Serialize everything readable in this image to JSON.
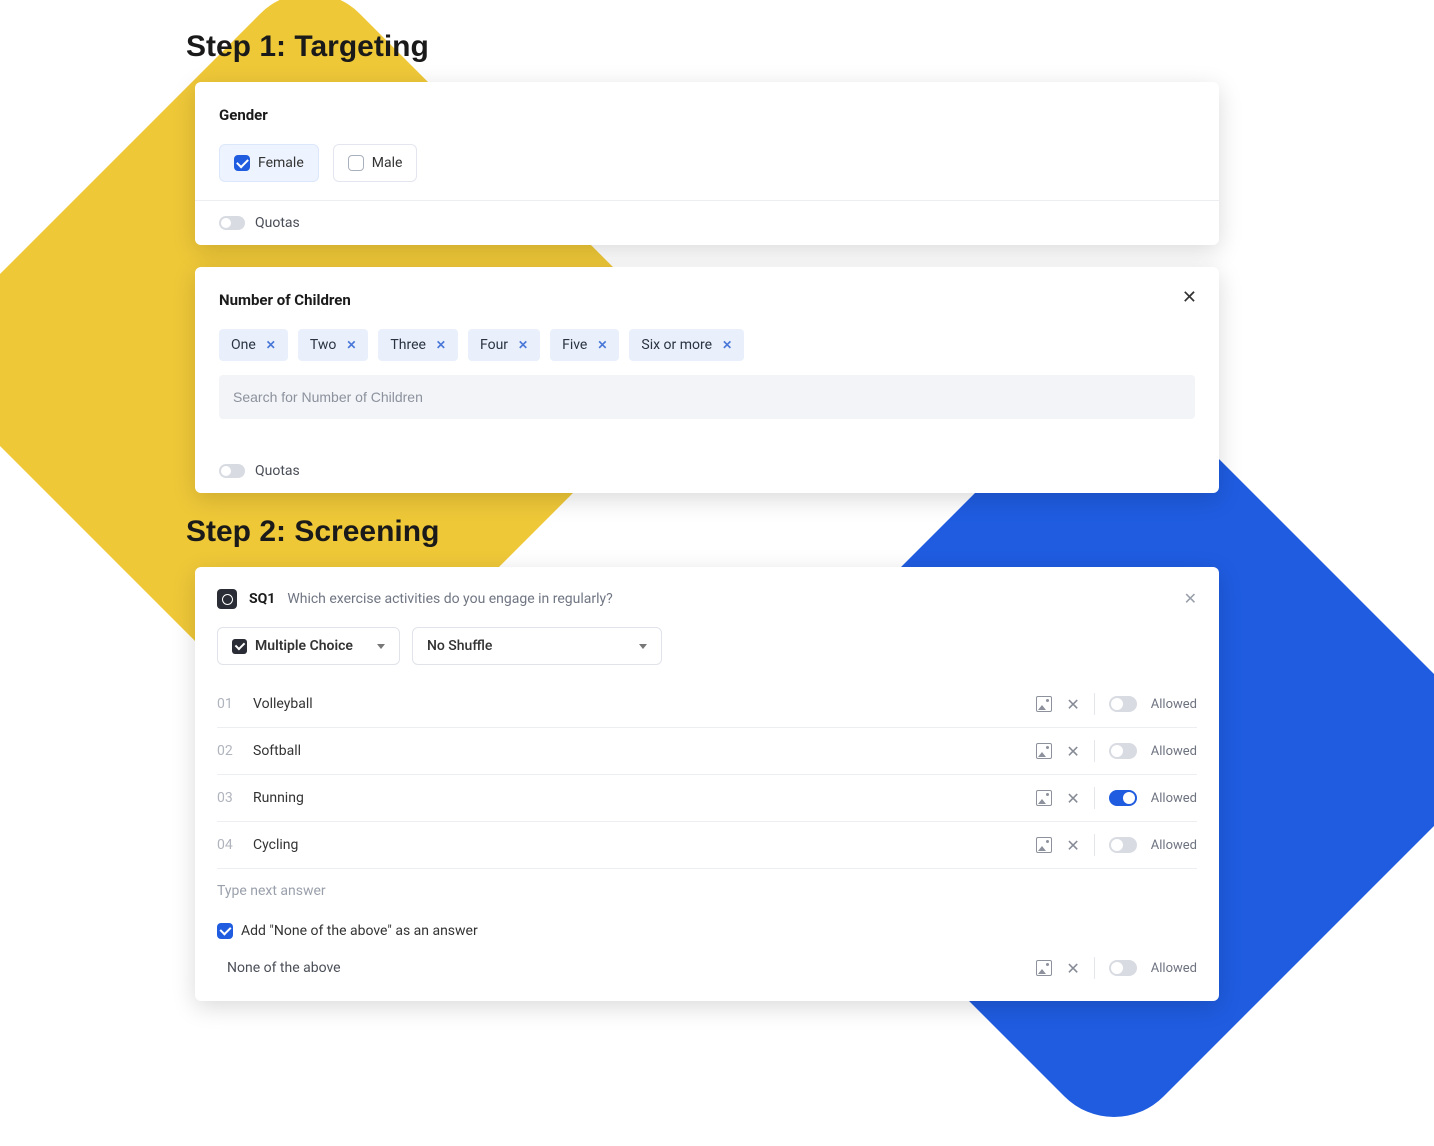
{
  "step1": {
    "heading": "Step 1: Targeting",
    "gender": {
      "title": "Gender",
      "options": [
        {
          "label": "Female",
          "checked": true
        },
        {
          "label": "Male",
          "checked": false
        }
      ],
      "quotas_label": "Quotas"
    },
    "children": {
      "title": "Number of Children",
      "chips": [
        "One",
        "Two",
        "Three",
        "Four",
        "Five",
        "Six or more"
      ],
      "search_placeholder": "Search for Number of Children",
      "quotas_label": "Quotas"
    }
  },
  "step2": {
    "heading": "Step 2: Screening",
    "question": {
      "id": "SQ1",
      "text": "Which exercise activities do you engage in regularly?",
      "type_label": "Multiple Choice",
      "shuffle_label": "No Shuffle",
      "answers": [
        {
          "num": "01",
          "text": "Volleyball",
          "allowed": false
        },
        {
          "num": "02",
          "text": "Softball",
          "allowed": false
        },
        {
          "num": "03",
          "text": "Running",
          "allowed": true
        },
        {
          "num": "04",
          "text": "Cycling",
          "allowed": false
        }
      ],
      "type_next_placeholder": "Type next answer",
      "nota_checkbox_label": "Add \"None of the above\" as an answer",
      "nota_label": "None of the above",
      "allowed_label": "Allowed"
    }
  }
}
